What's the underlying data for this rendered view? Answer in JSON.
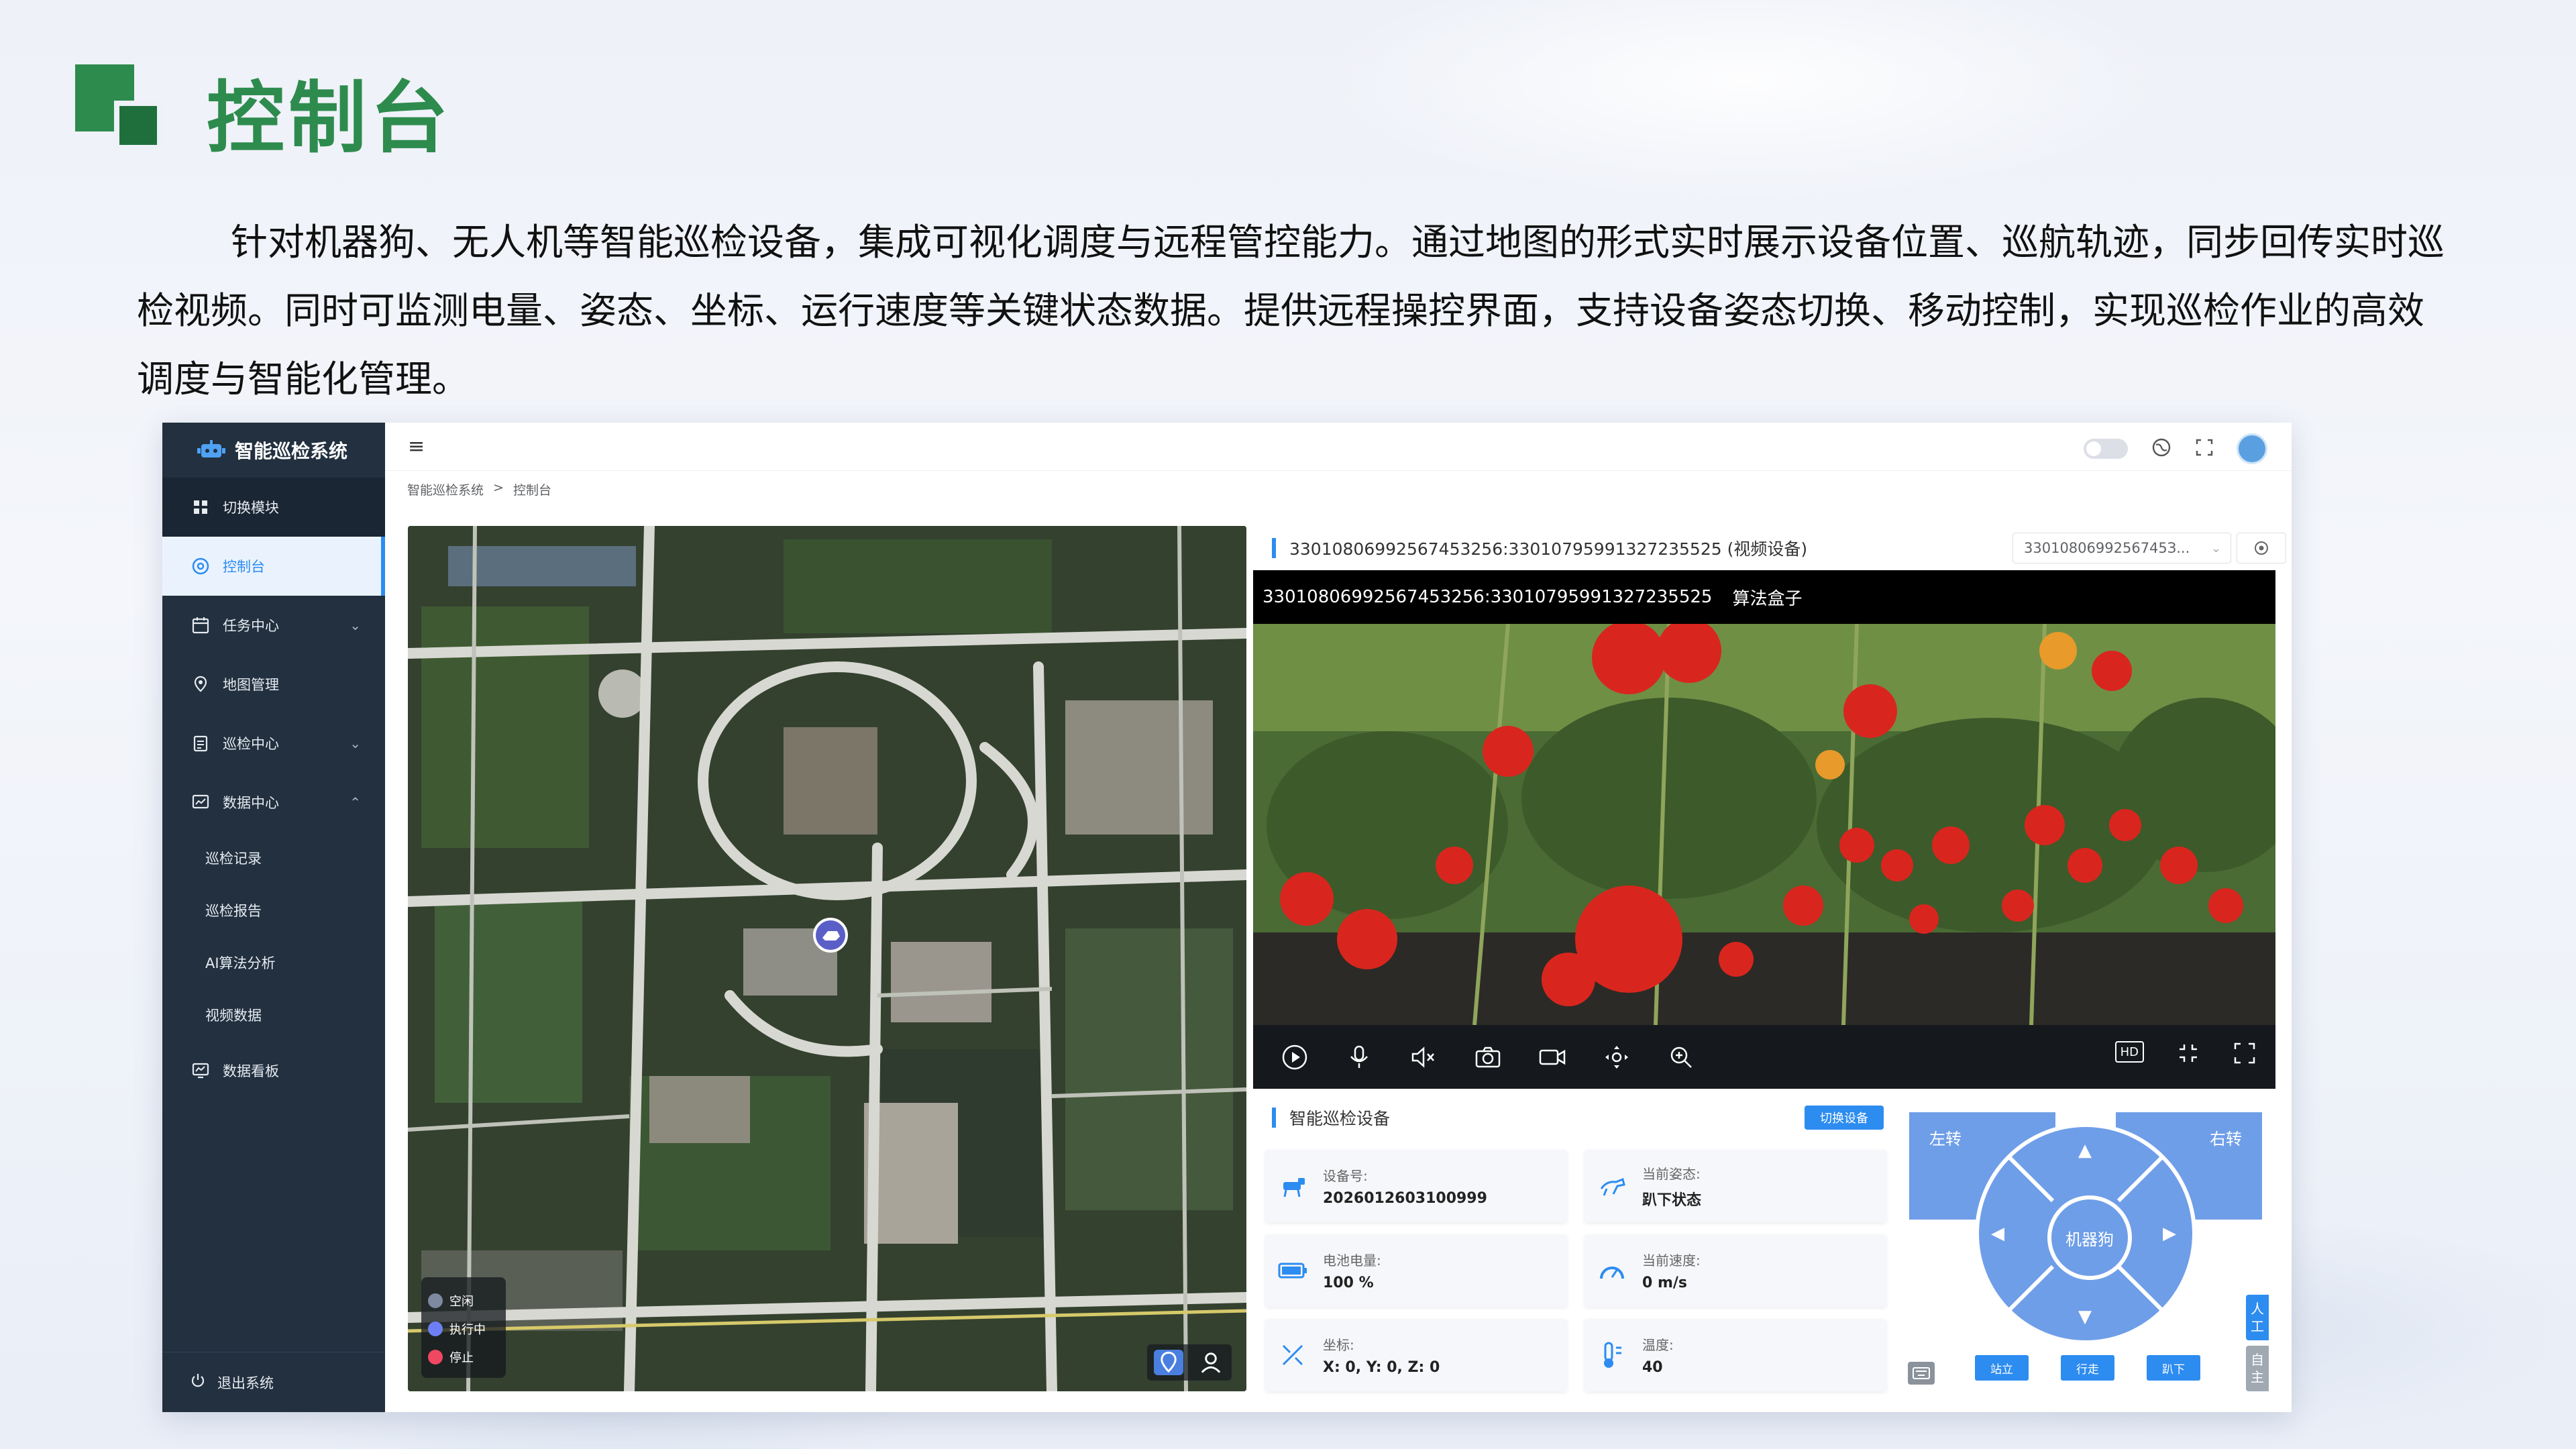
{
  "slide": {
    "title": "控制台",
    "description": "针对机器狗、无人机等智能巡检设备，集成可视化调度与远程管控能力。通过地图的形式实时展示设备位置、巡航轨迹，同步回传实时巡检视频。同时可监测电量、姿态、坐标、运行速度等关键状态数据。提供远程操控界面，支持设备姿态切换、移动控制，实现巡检作业的高效调度与智能化管理。",
    "accent_color": "#2e8b4e"
  },
  "sidebar": {
    "brand": "智能巡检系统",
    "switch_module": "切换模块",
    "items": [
      {
        "label": "控制台",
        "icon": "dashboard-icon"
      },
      {
        "label": "任务中心",
        "icon": "calendar-icon"
      },
      {
        "label": "地图管理",
        "icon": "map-icon"
      },
      {
        "label": "巡检中心",
        "icon": "clipboard-icon"
      },
      {
        "label": "数据中心",
        "icon": "data-icon"
      }
    ],
    "sub_items": [
      "巡检记录",
      "巡检报告",
      "AI算法分析",
      "视频数据"
    ],
    "dashboard_board": "数据看板",
    "logout": "退出系统"
  },
  "header": {
    "breadcrumb": [
      "智能巡检系统",
      "控制台"
    ]
  },
  "map": {
    "legend": [
      "空闲",
      "执行中",
      "停止"
    ],
    "legend_colors": [
      "#7d8aa0",
      "#6e7ff5",
      "#f04860"
    ]
  },
  "video": {
    "panel_title": "33010806992567453256:33010795991327235525 (视频设备)",
    "device_select": "3301080699256745З...",
    "caption_id": "33010806992567453256:33010795991327235525",
    "caption_label": "算法盒子",
    "hd_label": "HD"
  },
  "device": {
    "title": "智能巡检设备",
    "switch_button": "切换设备",
    "cards": [
      {
        "label": "设备号:",
        "value": "2026012603100999",
        "icon": "robot-dog-icon"
      },
      {
        "label": "当前姿态:",
        "value": "趴下状态",
        "icon": "pose-icon"
      },
      {
        "label": "电池电量:",
        "value": "100 %",
        "icon": "battery-icon"
      },
      {
        "label": "当前速度:",
        "value": "0 m/s",
        "icon": "speedometer-icon"
      },
      {
        "label": "坐标:",
        "value": "X: 0, Y: 0, Z: 0",
        "icon": "coordinate-icon"
      },
      {
        "label": "温度:",
        "value": "40",
        "icon": "thermometer-icon"
      }
    ]
  },
  "control": {
    "turn_left": "左转",
    "turn_right": "右转",
    "center": "机器狗",
    "actions": [
      "站立",
      "行走",
      "趴下"
    ],
    "side_tab_manual": "人工",
    "side_tab_auto": "自主"
  }
}
